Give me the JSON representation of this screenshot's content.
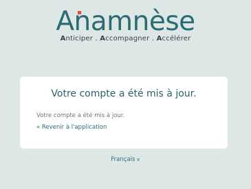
{
  "logo": {
    "text": "Anamnèse",
    "tagline": {
      "w1_initial": "A",
      "w1_rest": "nticiper",
      "sep1": " . ",
      "w2_initial": "A",
      "w2_rest": "ccompagner",
      "sep2": " . ",
      "w3_initial": "A",
      "w3_rest": "ccélérer"
    },
    "accent_color": "#e0523a",
    "brand_color": "#2b6c72"
  },
  "card": {
    "title": "Votre compte a été mis à jour.",
    "message": "Votre compte a été mis à jour.",
    "back_link": "« Revenir à l'application"
  },
  "language": {
    "selected": "Français",
    "chevron": "∨"
  }
}
